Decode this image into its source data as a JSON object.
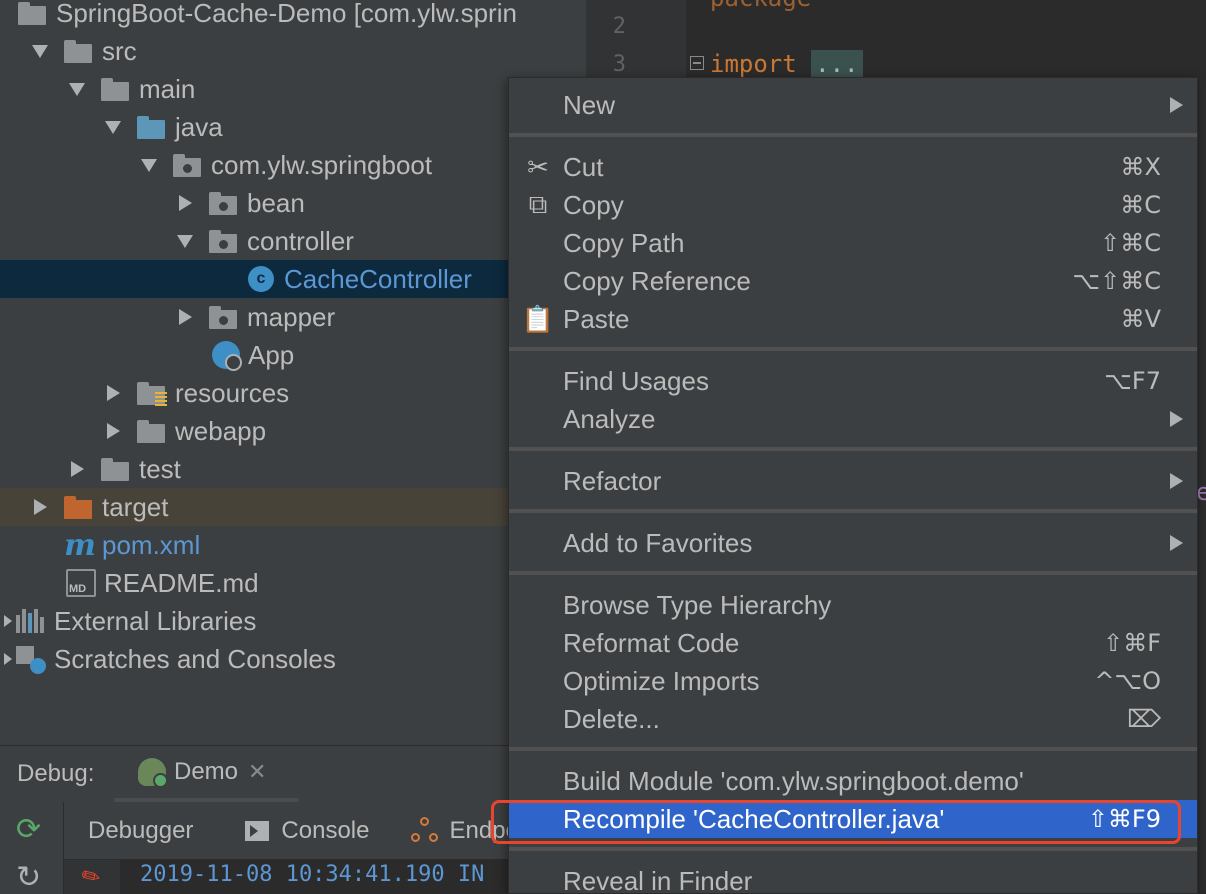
{
  "project_tree": {
    "items": [
      {
        "label": "SpringBoot-Cache-Demo [com.ylw.sprin",
        "icon": "module-folder-icon"
      },
      {
        "label": "src",
        "icon": "folder-icon"
      },
      {
        "label": "main",
        "icon": "folder-icon"
      },
      {
        "label": "java",
        "icon": "source-folder-icon"
      },
      {
        "label": "com.ylw.springboot",
        "icon": "package-icon"
      },
      {
        "label": "bean",
        "icon": "package-icon"
      },
      {
        "label": "controller",
        "icon": "package-icon"
      },
      {
        "label": "CacheController",
        "icon": "class-icon"
      },
      {
        "label": "mapper",
        "icon": "package-icon"
      },
      {
        "label": "App",
        "icon": "spring-boot-app-icon"
      },
      {
        "label": "resources",
        "icon": "resources-folder-icon"
      },
      {
        "label": "webapp",
        "icon": "folder-icon"
      },
      {
        "label": "test",
        "icon": "folder-icon"
      },
      {
        "label": "target",
        "icon": "excluded-folder-icon"
      },
      {
        "label": "pom.xml",
        "icon": "maven-icon"
      },
      {
        "label": "README.md",
        "icon": "markdown-file-icon"
      },
      {
        "label": "External Libraries",
        "icon": "libraries-icon"
      },
      {
        "label": "Scratches and Consoles",
        "icon": "scratches-icon"
      }
    ]
  },
  "editor": {
    "line_numbers": [
      "2",
      "3"
    ],
    "import_keyword": "import",
    "folded_text": "...",
    "peek_char": "e"
  },
  "debug": {
    "label": "Debug:",
    "run_tab": "Demo",
    "close_glyph": "✕",
    "tabs": {
      "debugger": "Debugger",
      "console": "Console",
      "endpoints": "Endpo"
    },
    "console_line": "2019-11-08 10:34:41.190  IN"
  },
  "context_menu": {
    "new": "New",
    "cut": "Cut",
    "cut_sc": "⌘X",
    "copy": "Copy",
    "copy_sc": "⌘C",
    "copy_path": "Copy Path",
    "copy_path_sc": "⇧⌘C",
    "copy_reference": "Copy Reference",
    "copy_reference_sc": "⌥⇧⌘C",
    "paste": "Paste",
    "paste_sc": "⌘V",
    "find_usages": "Find Usages",
    "find_usages_sc": "⌥F7",
    "analyze": "Analyze",
    "refactor": "Refactor",
    "add_to_favorites": "Add to Favorites",
    "browse_type_hierarchy": "Browse Type Hierarchy",
    "reformat_code": "Reformat Code",
    "reformat_code_sc": "⇧⌘F",
    "optimize_imports": "Optimize Imports",
    "optimize_imports_sc": "^⌥O",
    "delete": "Delete...",
    "delete_sc": "⌦",
    "build_module": "Build Module 'com.ylw.springboot.demo'",
    "recompile": "Recompile 'CacheController.java'",
    "recompile_sc": "⇧⌘F9",
    "reveal_in_finder": "Reveal in Finder"
  },
  "colors": {
    "selection": "#0d293e",
    "menu_highlight": "#2f65ca",
    "annotation_ring": "#e8452c",
    "keyword": "#cc7832"
  }
}
